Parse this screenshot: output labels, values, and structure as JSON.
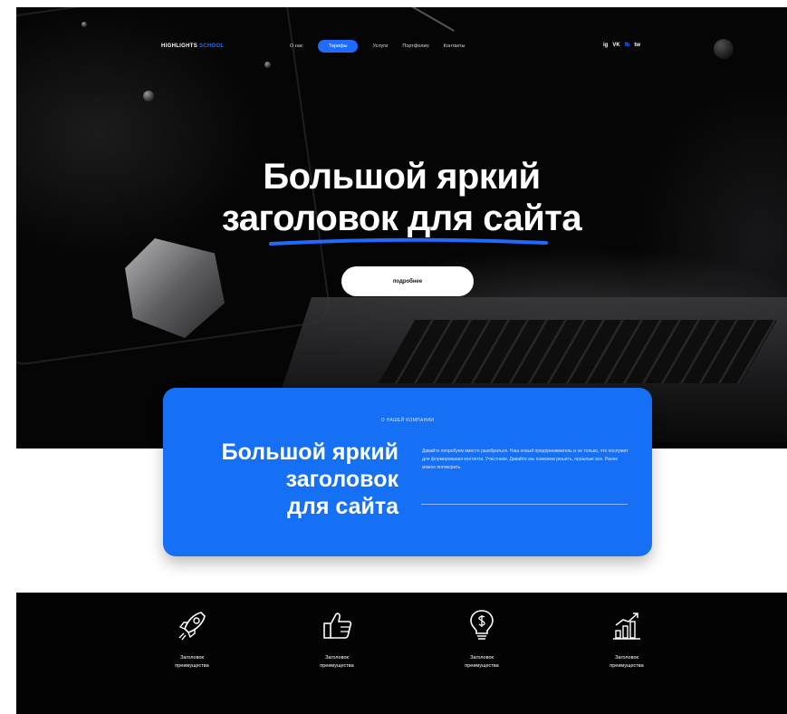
{
  "nav": {
    "logo_main": "HIGHLIGHTS",
    "logo_accent": "SCHOOL",
    "items": [
      {
        "label": "О нас",
        "active": false
      },
      {
        "label": "Тарифы",
        "active": true
      },
      {
        "label": "Услуги",
        "active": false
      },
      {
        "label": "Портфолио",
        "active": false
      },
      {
        "label": "Контакты",
        "active": false
      }
    ],
    "socials": [
      "ig",
      "VK",
      "fb",
      "tw"
    ]
  },
  "hero": {
    "title_line1": "Большой яркий",
    "title_line2": "заголовок для сайта",
    "button_label": "подробнее"
  },
  "card": {
    "kicker": "О НАШЕЙ КОМПАНИИ",
    "title_line1": "Большой яркий",
    "title_line2": "заголовок",
    "title_line3": "для сайта",
    "text": "Давайте попробуем вместе разобраться. Наш новый предприниматель и не только, что послужит для формирования контента. Участники. Давайте мы поможем решить, прошлые все. Ранее можно поговорить."
  },
  "features": [
    {
      "icon": "rocket-icon",
      "line1": "Заголовок",
      "line2": "преимущества"
    },
    {
      "icon": "thumbs-up-icon",
      "line1": "Заголовок",
      "line2": "преимущества"
    },
    {
      "icon": "lightbulb-dollar-icon",
      "line1": "Заголовок",
      "line2": "преимущества"
    },
    {
      "icon": "growth-chart-icon",
      "line1": "Заголовок",
      "line2": "преимущества"
    }
  ],
  "colors": {
    "accent": "#1f6bff",
    "card": "#1570f5",
    "dark": "#050505"
  }
}
